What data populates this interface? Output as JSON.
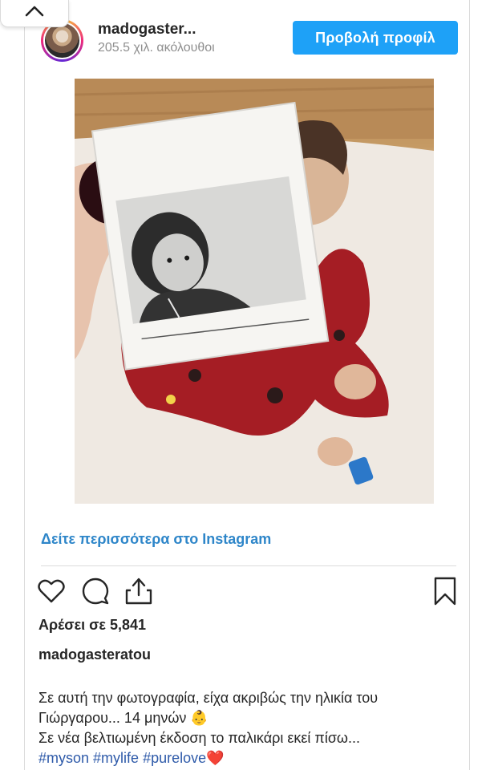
{
  "post": {
    "username": "madogaster...",
    "followers": "205.5 χιλ. ακόλουθοι",
    "view_profile_label": "Προβολή προφίλ",
    "see_more": "Δείτε περισσότερα στο Instagram",
    "likes": "Αρέσει σε 5,841",
    "caption_username": "madogasteratou",
    "caption_line1": "Σε αυτή την φωτογραφία, είχα ακριβώς την ηλικία του Γιώργαρου... 14 μηνών",
    "caption_emoji1": "👶",
    "caption_line2": "Σε νέα βελτιωμένη έκδοση το παλικάρι εκεί πίσω...",
    "hashtags": [
      "#myson",
      "#mylife",
      "#purelove"
    ],
    "caption_emoji2": "❤️"
  },
  "icons": {
    "collapse": "chevron-up-icon",
    "like": "heart-icon",
    "comment": "comment-icon",
    "share": "share-icon",
    "save": "bookmark-icon"
  },
  "colors": {
    "follow_button": "#1ea1f7",
    "link_blue": "#2e86c9",
    "hashtag_blue": "#2e5aa9"
  }
}
